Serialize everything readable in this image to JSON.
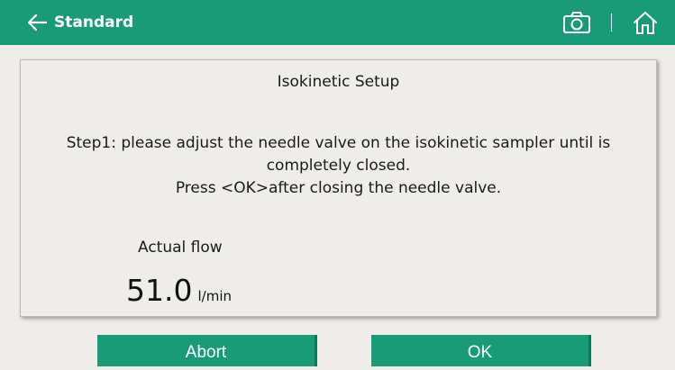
{
  "header": {
    "back_label": "Standard",
    "icons": {
      "back": "arrow-left-icon",
      "camera": "camera-icon",
      "home": "home-icon"
    },
    "color": "#1a9b78"
  },
  "dialog": {
    "title": "Isokinetic Setup",
    "instruction_line1": "Step1: please adjust the needle valve on the isokinetic sampler until is completely closed.",
    "instruction_line2": "Press <OK>after closing the needle valve.",
    "flow_label": "Actual flow",
    "flow_value": "51.0",
    "flow_unit": "l/min"
  },
  "buttons": {
    "abort_label": "Abort",
    "ok_label": "OK"
  }
}
